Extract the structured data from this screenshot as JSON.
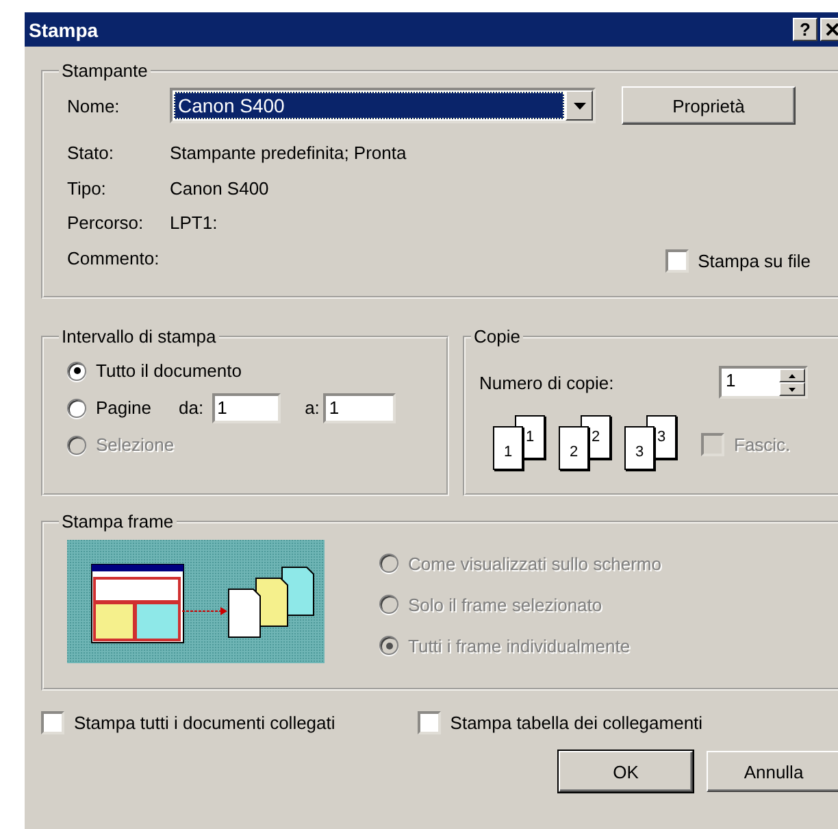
{
  "window": {
    "title": "Stampa",
    "help_label": "?"
  },
  "printer": {
    "legend": "Stampante",
    "name_label": "Nome:",
    "name_value": "Canon S400",
    "properties_button": "Proprietà",
    "info": [
      {
        "label": "Stato:",
        "value": "Stampante predefinita; Pronta"
      },
      {
        "label": "Tipo:",
        "value": "Canon S400"
      },
      {
        "label": "Percorso:",
        "value": "LPT1:"
      },
      {
        "label": "Commento:"
      }
    ],
    "print_to_file": {
      "label": "Stampa su file",
      "checked": false
    }
  },
  "range": {
    "legend": "Intervallo di stampa",
    "options": [
      {
        "kind": "all",
        "label": "Tutto il documento",
        "selected": true,
        "disabled": false
      },
      {
        "kind": "pages",
        "label": "Pagine",
        "selected": false,
        "disabled": false
      },
      {
        "kind": "selection",
        "label": "Selezione",
        "selected": false,
        "disabled": true
      }
    ],
    "from_label": "da:",
    "from_value": "1",
    "to_label": "a:",
    "to_value": "1"
  },
  "copies": {
    "legend": "Copie",
    "count_label": "Numero di copie:",
    "count_value": "1",
    "collate_pages": [
      {
        "back": "1",
        "front": "1"
      },
      {
        "back": "2",
        "front": "2"
      },
      {
        "back": "3",
        "front": "3"
      }
    ],
    "collate": {
      "label": "Fascic.",
      "checked": false,
      "disabled": true
    }
  },
  "frames": {
    "legend": "Stampa frame",
    "options": [
      {
        "label": "Come visualizzati sullo schermo",
        "selected": false,
        "disabled": true
      },
      {
        "label": "Solo il frame selezionato",
        "selected": false,
        "disabled": true
      },
      {
        "label": "Tutti i frame individualmente",
        "selected": true,
        "disabled": true
      }
    ]
  },
  "extra_options": [
    {
      "label": "Stampa tutti i documenti collegati",
      "checked": false
    },
    {
      "label": "Stampa tabella dei collegamenti",
      "checked": false
    }
  ],
  "buttons": [
    {
      "label": "OK",
      "default": true
    },
    {
      "label": "Annulla",
      "default": false
    }
  ]
}
